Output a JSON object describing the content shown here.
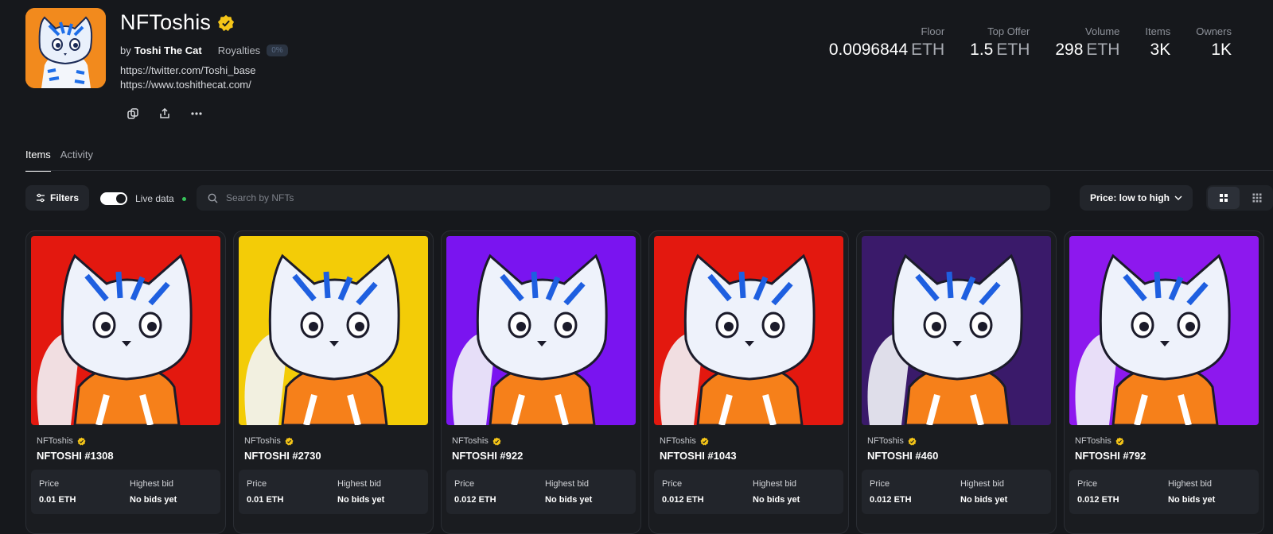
{
  "collection": {
    "title": "NFToshis",
    "by_prefix": "by",
    "owner": "Toshi The Cat",
    "royalties_label": "Royalties",
    "royalties_badge": "0%",
    "links": [
      "https://twitter.com/Toshi_base",
      "https://www.toshithecat.com/"
    ]
  },
  "stats": [
    {
      "label": "Floor",
      "value": "0.0096844",
      "unit": "ETH"
    },
    {
      "label": "Top Offer",
      "value": "1.5",
      "unit": "ETH"
    },
    {
      "label": "Volume",
      "value": "298",
      "unit": "ETH"
    },
    {
      "label": "Items",
      "value": "3K",
      "unit": ""
    },
    {
      "label": "Owners",
      "value": "1K",
      "unit": ""
    }
  ],
  "tabs": [
    {
      "label": "Items",
      "active": true
    },
    {
      "label": "Activity",
      "active": false
    }
  ],
  "toolbar": {
    "filters_label": "Filters",
    "live_label": "Live data",
    "search_placeholder": "Search by NFTs",
    "sort_label": "Price: low to high"
  },
  "cards": [
    {
      "collection": "NFToshis",
      "name": "NFTOSHI #1308",
      "price_label": "Price",
      "price": "0.01 ETH",
      "bid_label": "Highest bid",
      "bid": "No bids yet",
      "bg": "#e3180f"
    },
    {
      "collection": "NFToshis",
      "name": "NFTOSHI #2730",
      "price_label": "Price",
      "price": "0.01 ETH",
      "bid_label": "Highest bid",
      "bid": "No bids yet",
      "bg": "#f3cc07"
    },
    {
      "collection": "NFToshis",
      "name": "NFTOSHI #922",
      "price_label": "Price",
      "price": "0.012 ETH",
      "bid_label": "Highest bid",
      "bid": "No bids yet",
      "bg": "#7a14f0"
    },
    {
      "collection": "NFToshis",
      "name": "NFTOSHI #1043",
      "price_label": "Price",
      "price": "0.012 ETH",
      "bid_label": "Highest bid",
      "bid": "No bids yet",
      "bg": "#e3180f"
    },
    {
      "collection": "NFToshis",
      "name": "NFTOSHI #460",
      "price_label": "Price",
      "price": "0.012 ETH",
      "bid_label": "Highest bid",
      "bid": "No bids yet",
      "bg": "#3a1a6a"
    },
    {
      "collection": "NFToshis",
      "name": "NFTOSHI #792",
      "price_label": "Price",
      "price": "0.012 ETH",
      "bid_label": "Highest bid",
      "bid": "No bids yet",
      "bg": "#8d18ee"
    }
  ]
}
